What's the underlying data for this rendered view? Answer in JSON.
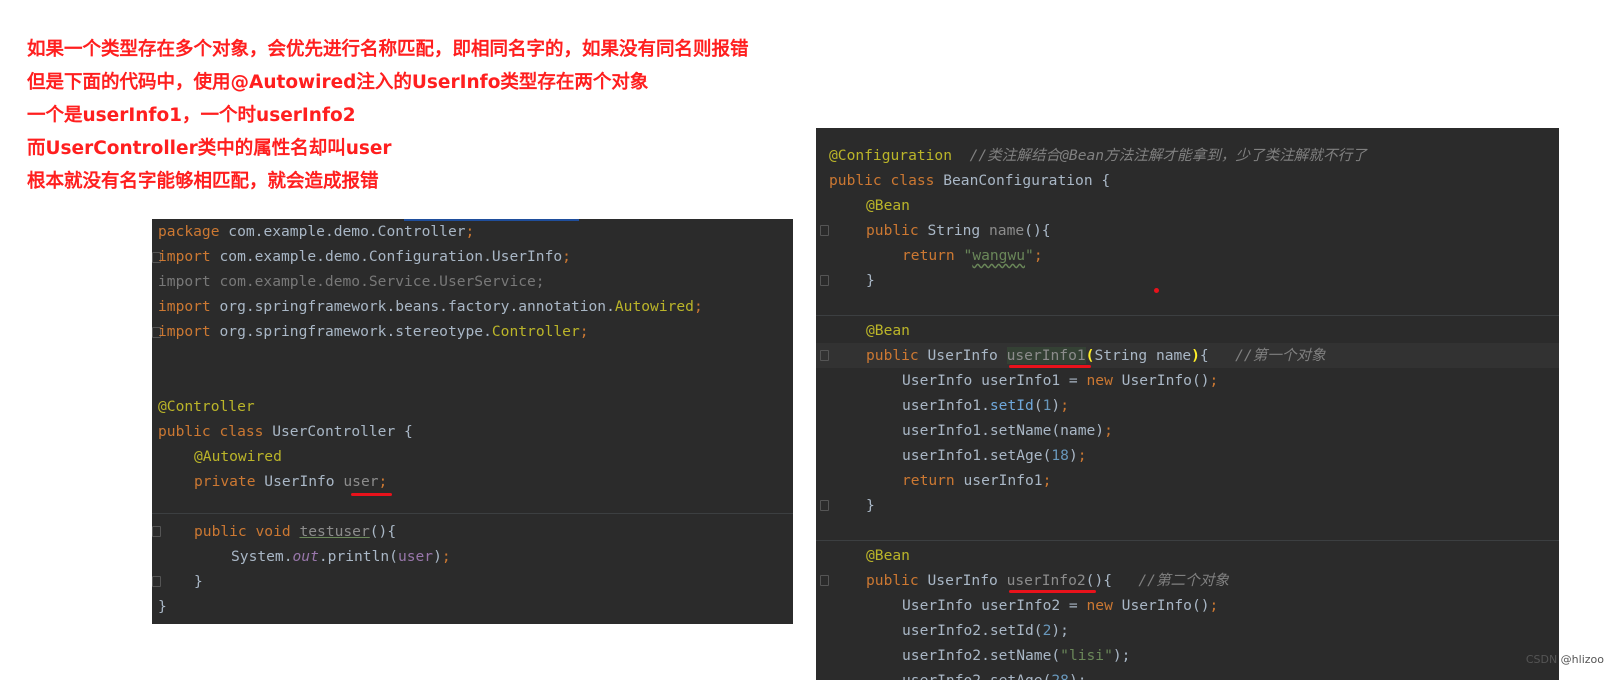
{
  "notes": [
    "如果一个类型存在多个对象，会优先进行名称匹配，即相同名字的，如果没有同名则报错",
    "但是下面的代码中，使用@Autowired注入的UserInfo类型存在两个对象",
    "一个是userInfo1，一个时userInfo2",
    "而UserController类中的属性名却叫user",
    "根本就没有名字能够相匹配，就会造成报错"
  ],
  "left_code": {
    "package_kw": "package",
    "package_name": " com.example.demo.Controller",
    "semi": ";",
    "import_kw": "import",
    "import1": " com.example.demo.Configuration.UserInfo",
    "import2": "import com.example.demo.Service.UserService;",
    "import3_path": " org.springframework.beans.factory.annotation.",
    "import3_cls": "Autowired",
    "import4_path": " org.springframework.stereotype.",
    "import4_cls": "Controller",
    "anno_controller": "@Controller",
    "public_kw": "public",
    "class_kw": "class",
    "class_decl": " UserController {",
    "anno_autowired": "@Autowired",
    "private_kw": "private",
    "field_type": " UserInfo ",
    "field_name": "user",
    "void_kw": "void",
    "method_name": "testuser",
    "method_tail": "(){",
    "sys": "System.",
    "out": "out",
    "println": ".println(",
    "arg": "user",
    "close_call": ")",
    "close_brace_inner": "}",
    "close_brace_outer": "}"
  },
  "right_code": {
    "anno_config": "@Configuration",
    "comment1": "//类注解结合@Bean方法注解才能拿到，少了类注解就不行了",
    "public_kw": "public",
    "class_kw": "class",
    "class_name": " BeanConfiguration {",
    "anno_bean": "@Bean",
    "string_type": " String ",
    "name_method": "name",
    "paren_open": "(){",
    "return_kw": "return",
    "str_wangwu": "wangwu",
    "close_brace": "}",
    "userinfo_type": " UserInfo ",
    "method1": "userInfo1",
    "param": "String name",
    "open_paren": "(",
    "close_paren": ")",
    "brace_open": "{",
    "comment2": "//第一个对象",
    "new_line1_pre": "UserInfo userInfo1 = ",
    "new_kw": "new",
    "new_ctor": " UserInfo()",
    "setid1": "userInfo1.",
    "setid_m": "setId",
    "num1": "1",
    "setname1": "userInfo1.setName(name)",
    "setage1": "userInfo1.setAge(",
    "num18": "18",
    "return_var1": " userInfo1",
    "method2": "userInfo2",
    "paren2": "(){",
    "comment3": "//第二个对象",
    "new_line2_pre": "UserInfo userInfo2 = ",
    "setid2": "userInfo2.setId(",
    "num2": "2",
    "setname2": "userInfo2.setName(",
    "str_lisi": "\"lisi\"",
    "setage2": "userInfo2.setAge(",
    "num28": "28",
    "semi": ";",
    "paren_close_semi": ");"
  },
  "watermark": "CSDN @hlizoo",
  "colors": {
    "note_red": "#ff1f1f",
    "editor_bg": "#2b2b2b",
    "keyword": "#cc7832",
    "annotation": "#bbb529",
    "string": "#6a8759",
    "number": "#6897bb",
    "comment": "#808080",
    "field": "#9876aa",
    "default_text": "#a9b7c6",
    "red_underline": "#e8121b"
  }
}
